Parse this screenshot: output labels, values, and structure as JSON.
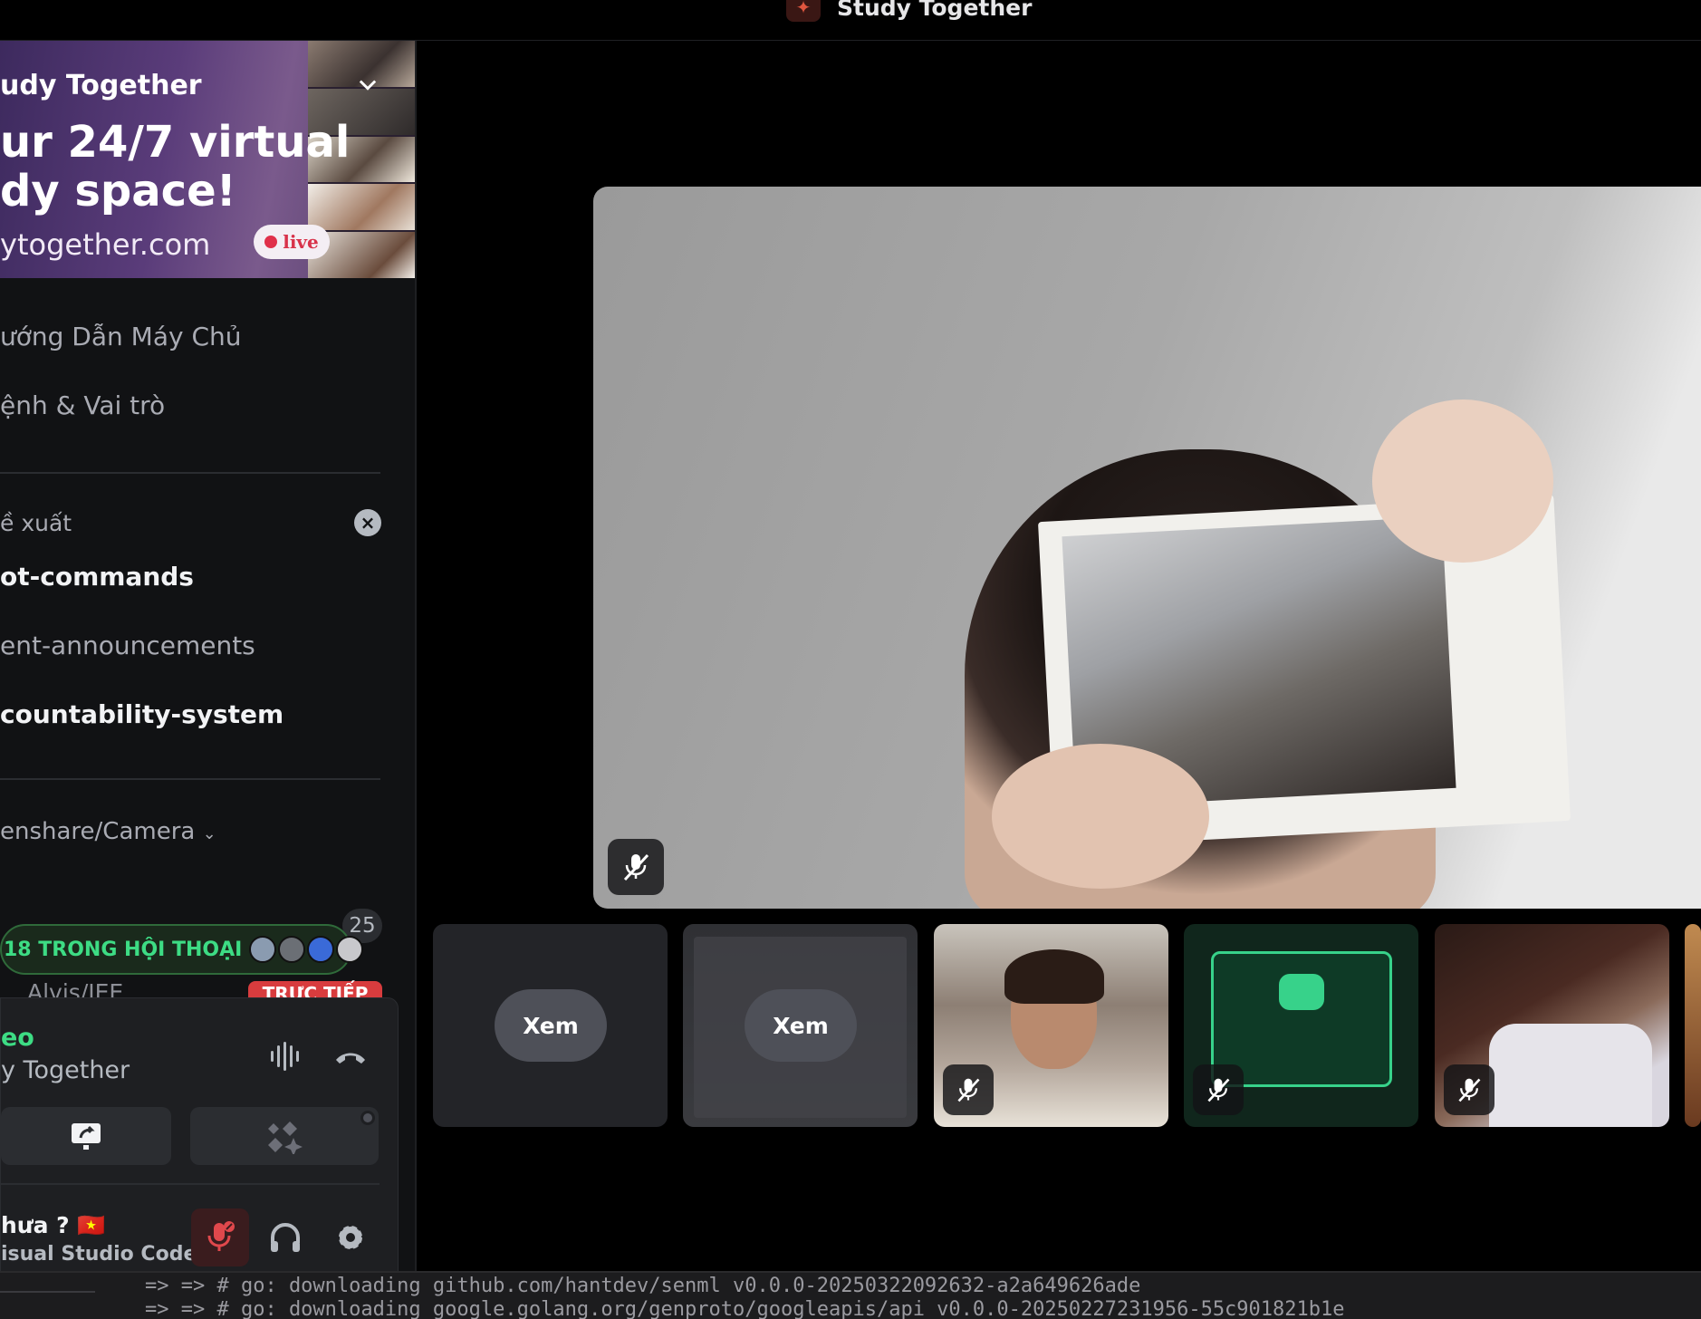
{
  "window": {
    "title": "Study Together"
  },
  "sidebar": {
    "banner": {
      "server_name": "udy Together",
      "tagline_line1": "ur 24/7 virtual",
      "tagline_line2": "dy space!",
      "url": "ytogether.com",
      "live_badge": "live"
    },
    "items": [
      {
        "label": "ướng Dẫn Máy Chủ"
      },
      {
        "label": "ệnh & Vai trò"
      }
    ],
    "suggested_section": "ề xuất",
    "suggested_channels": [
      {
        "label": "ot-commands"
      },
      {
        "label": "ent-announcements"
      },
      {
        "label": "countability-system"
      }
    ],
    "category": "enshare/Camera",
    "voice_channel_count": "25",
    "conversation_pill": "18 TRONG HỘI THOẠI",
    "live_user": "Alvis/JEE",
    "live_badge": "TRỰC TIẾP"
  },
  "voice_panel": {
    "status": "eo",
    "server": "y Together",
    "user_name": "hưa ?",
    "flag": "🇻🇳",
    "activity": "isual Studio Code"
  },
  "tiles": [
    {
      "action": "Xem"
    },
    {
      "action": "Xem"
    }
  ],
  "terminal": {
    "line1": "=> => # go: downloading github.com/hantdev/senml v0.0.0-20250322092632-a2a649626ade",
    "line2": "=> => # go: downloading google.golang.org/genproto/googleapis/api v0.0.0-20250227231956-55c901821b1e"
  },
  "colors": {
    "connected_green": "#3ddc84",
    "live_red": "#d83c3e",
    "sidebar_bg": "#111214",
    "panel_bg": "#1e1f22"
  }
}
